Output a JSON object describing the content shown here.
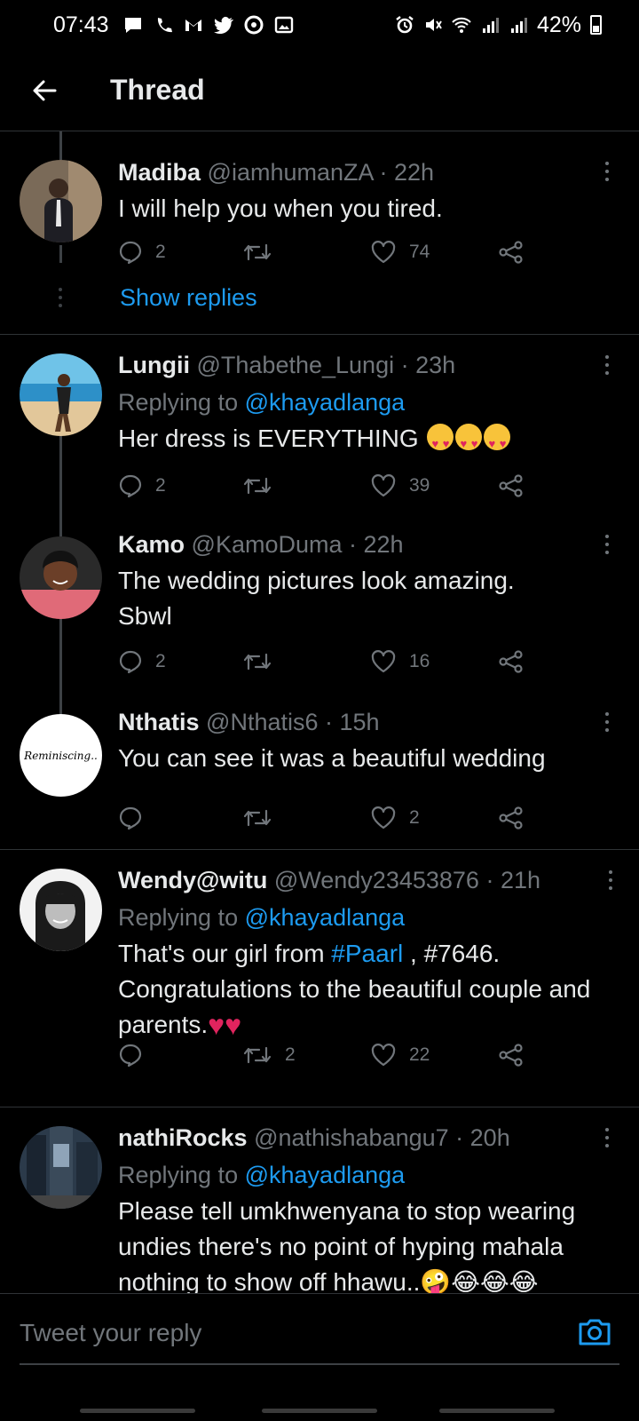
{
  "status_bar": {
    "time": "07:43",
    "battery": "42%"
  },
  "header": {
    "title": "Thread"
  },
  "tweets": [
    {
      "name": "Madiba",
      "handle": "@iamhumanZA",
      "time": "· 22h",
      "text": "I will help you when you tired.",
      "replies": "2",
      "retweets": "",
      "likes": "74",
      "show_replies": "Show replies"
    },
    {
      "name": "Lungii",
      "handle": "@Thabethe_Lungi",
      "time": "· 23h",
      "replying_prefix": "Replying to",
      "replying_to": "@khayadlanga",
      "text": "Her dress is EVERYTHING",
      "replies": "2",
      "retweets": "",
      "likes": "39"
    },
    {
      "name": "Kamo",
      "handle": "@KamoDuma",
      "time": "· 22h",
      "text": "The wedding pictures look amazing. Sbwl",
      "replies": "2",
      "retweets": "",
      "likes": "16"
    },
    {
      "name": "Nthatis",
      "handle": "@Nthatis6",
      "time": "· 15h",
      "avatar_text": "Reminiscing..",
      "text": "You can see it was a beautiful wedding",
      "replies": "",
      "retweets": "",
      "likes": "2"
    },
    {
      "name": "Wendy@witu",
      "handle": "@Wendy23453876",
      "time": "· 21h",
      "replying_prefix": "Replying to",
      "replying_to": "@khayadlanga",
      "text_pre": "That's our girl from ",
      "hashtag": "#Paarl",
      "text_post": " , #7646. Congratulations to the beautiful couple and parents.",
      "replies": "",
      "retweets": "2",
      "likes": "22"
    },
    {
      "name": "nathiRocks",
      "handle": "@nathishabangu7",
      "time": "· 20h",
      "replying_prefix": "Replying to",
      "replying_to": "@khayadlanga",
      "text": "Please tell umkhwenyana to stop wearing undies there's no point of hyping mahala nothing to show off hhawu..",
      "emoji": "🤪😂😂😂"
    }
  ],
  "compose": {
    "placeholder": "Tweet your reply"
  },
  "colors": {
    "accent": "#1d9bf0",
    "background": "#000000",
    "muted": "#71767b",
    "divider": "#2f3336"
  }
}
